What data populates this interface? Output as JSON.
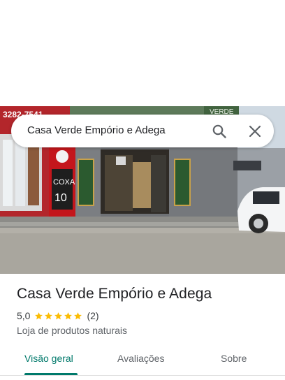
{
  "search": {
    "query": "Casa Verde Empório e Adega"
  },
  "photo": {
    "sign_text": "COXA",
    "sign_price": "10",
    "facade_text": "VERDE",
    "phone_text": "3282-7541"
  },
  "place": {
    "name": "Casa Verde Empório e Adega",
    "rating": "5,0",
    "stars_filled": 5,
    "review_count": "(2)",
    "category": "Loja de produtos naturais"
  },
  "tabs": [
    {
      "label": "Visão geral",
      "active": true
    },
    {
      "label": "Avaliações",
      "active": false
    },
    {
      "label": "Sobre",
      "active": false
    }
  ],
  "colors": {
    "accent": "#00796b",
    "star": "#fbbc04"
  }
}
